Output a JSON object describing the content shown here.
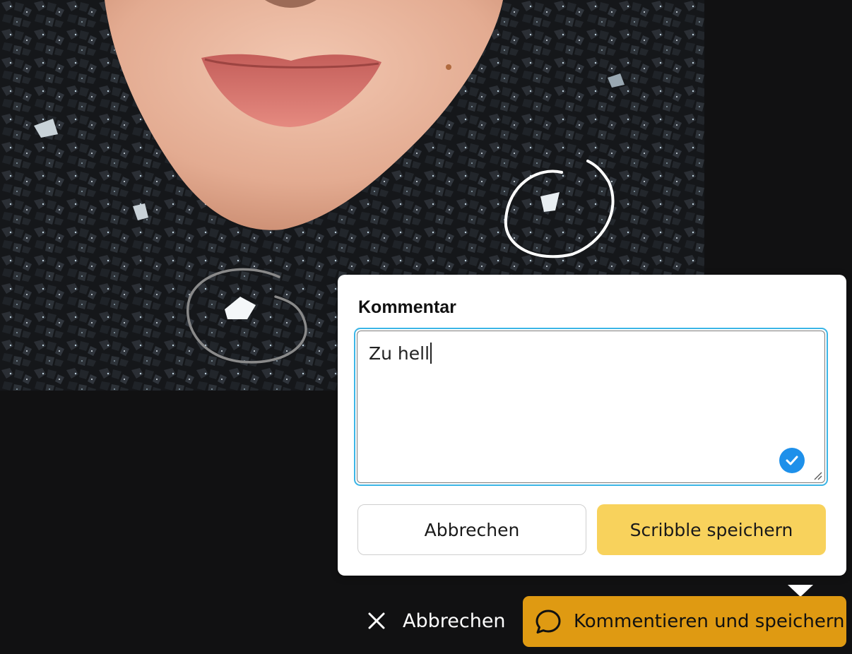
{
  "comment_popover": {
    "title": "Kommentar",
    "comment_text": "Zu hell",
    "cancel_label": "Abbrechen",
    "save_label": "Scribble speichern"
  },
  "bottom_bar": {
    "cancel_label": "Abbrechen",
    "primary_label": "Kommentieren und speichern"
  },
  "icons": {
    "textarea_status": "check-circle-icon",
    "cancel": "close-icon",
    "primary": "speech-bubble-icon"
  },
  "colors": {
    "background": "#111112",
    "primary_button": "#df9a12",
    "save_button": "#f8d25c",
    "focus_border": "#3bb5e6",
    "check_badge": "#1e90ea",
    "scribble_active": "#ffffff",
    "scribble_inactive": "#8a8a8a"
  }
}
